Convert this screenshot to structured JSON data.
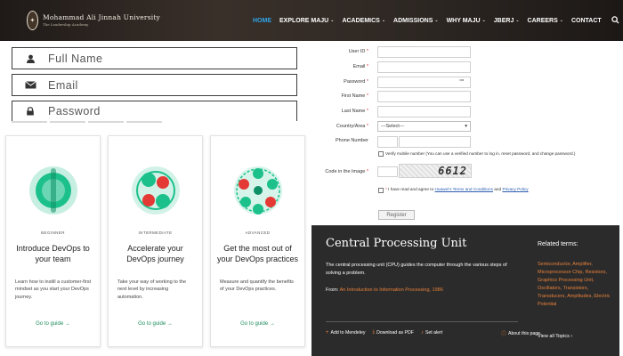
{
  "header": {
    "logo_name": "Mohammad Ali Jinnah University",
    "logo_tagline": "The Leadership Academy",
    "nav": [
      {
        "label": "HOME",
        "caret": false
      },
      {
        "label": "EXPLORE MAJU",
        "caret": true
      },
      {
        "label": "ACADEMICS",
        "caret": true
      },
      {
        "label": "ADMISSIONS",
        "caret": true
      },
      {
        "label": "WHY MAJU",
        "caret": true
      },
      {
        "label": "JBERJ",
        "caret": true
      },
      {
        "label": "CAREERS",
        "caret": true
      },
      {
        "label": "CONTACT",
        "caret": false
      }
    ],
    "caret_glyph": "⌄",
    "search_icon": "search-icon"
  },
  "signup": {
    "full_name_placeholder": "Full Name",
    "email_placeholder": "Email",
    "password_placeholder": "Password"
  },
  "cards": [
    {
      "level": "BEGINNER",
      "title": "Introduce DevOps to your team",
      "desc": "Learn how to instill a customer-first mindset as you start your DevOps journey.",
      "link": "Go to guide →",
      "accent": "#1cc08a"
    },
    {
      "level": "INTERMEDIATE",
      "title": "Accelerate your DevOps journey",
      "desc": "Take your way of working to the next level by increasing automation.",
      "link": "Go to guide →",
      "accent": "#1cc08a"
    },
    {
      "level": "ADVANCED",
      "title": "Get the most out of your DevOps practices",
      "desc": "Measure and quantify the benefits of your DevOps practices.",
      "link": "Go to guide →",
      "accent": "#1cc08a"
    }
  ],
  "registration": {
    "labels": {
      "user_id": "User ID",
      "email": "Email",
      "password": "Password",
      "first_name": "First Name",
      "last_name": "Last Name",
      "country": "Country/Area",
      "phone": "Phone Number",
      "captcha": "Code in the Image"
    },
    "required_mark": "*",
    "country_value": "---Select---",
    "mobile_check": "Verify mobile number (You can use a verified number to log in, reset password, and change password.)",
    "agree_prefix": "I have read and agree to",
    "agree_terms": "Huawei's Terms and Conditions",
    "agree_and": "and",
    "agree_privacy": "Privacy Policy",
    "captcha_code": "6612",
    "register_label": "Register"
  },
  "panel": {
    "title": "Central Processing Unit",
    "body": "The central processing unit (CPU) guides the computer through the various steps of solving a problem.",
    "from_prefix": "From:",
    "from_link": "An Introduction to Information Processing, 1986",
    "actions": [
      "Add to Mendeley",
      "Download as PDF",
      "Set alert"
    ],
    "about": "About this page",
    "related_heading": "Related terms:",
    "related_terms": "Semiconductor, Amplifier, Microprocessor Chip, Resistors, Graphics Processing Unit, Oscillators, Transistors, Transducers, Amplitudes, Electric Potential",
    "view_all": "View all Topics",
    "accent": "#e8813a"
  }
}
